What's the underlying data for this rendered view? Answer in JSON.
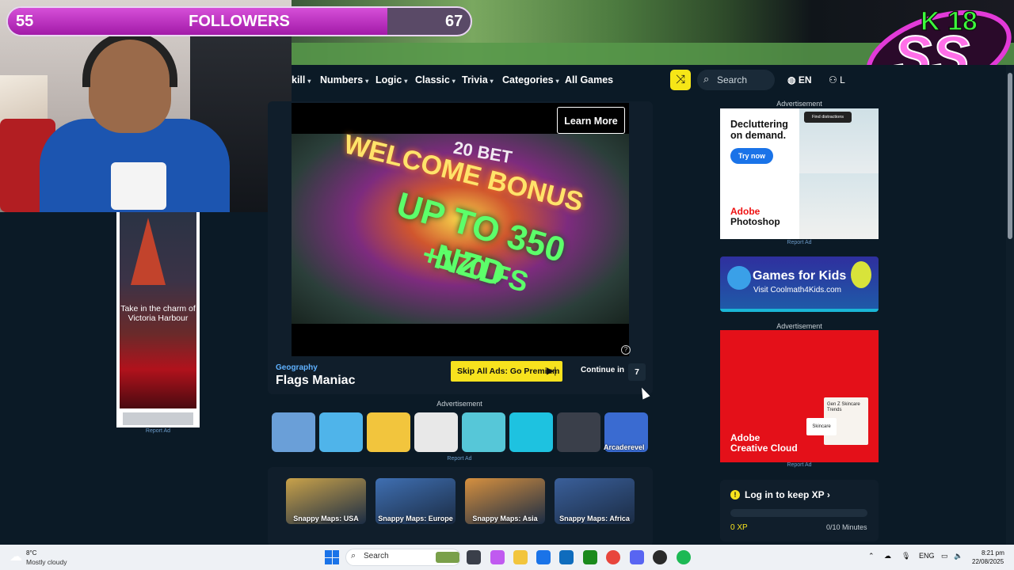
{
  "overlay": {
    "followers_label": "FOLLOWERS",
    "current": "55",
    "goal": "67",
    "progress_fraction": 0.82,
    "logo_text": "K 18",
    "logo_sub": "SS"
  },
  "nav": {
    "items": [
      {
        "label": "kill",
        "caret": true
      },
      {
        "label": "Numbers",
        "caret": true
      },
      {
        "label": "Logic",
        "caret": true
      },
      {
        "label": "Classic",
        "caret": true
      },
      {
        "label": "Trivia",
        "caret": true
      },
      {
        "label": "Categories",
        "caret": true
      },
      {
        "label": "All Games",
        "caret": false
      }
    ],
    "search_label": "Search",
    "language": "EN",
    "login_label": "L"
  },
  "video_ad": {
    "learn_more": "Learn More",
    "bet_brand": "20 BET",
    "headline1": "WELCOME BONUS",
    "headline2": "UP TO 350 NZD",
    "headline3": "+170 FS",
    "help": "?"
  },
  "game": {
    "category": "Geography",
    "title": "Flags Maniac",
    "skip_ads": "Skip All Ads: Go Premium",
    "continue_label": "Continue in",
    "countdown": "7"
  },
  "ads": {
    "advertisement": "Advertisement",
    "report": "Report Ad",
    "tiles_watermark": "Arcaderevel",
    "tiles": [
      "#6a9fd8",
      "#4fb4ea",
      "#f2c53d",
      "#e8e8e8",
      "#56c7d8",
      "#1ec2e0",
      "#3a3f4a",
      "#3a6bd1"
    ],
    "vertical_ad_text": "Take in the charm of Victoria Harbour",
    "photoshop_head": "Decluttering on demand.",
    "photoshop_cta": "Try now",
    "photoshop_brand1": "Adobe",
    "photoshop_brand2": "Photoshop",
    "photoshop_chip": "Find distractions",
    "kids_title": "Games for Kids",
    "kids_sub": "Visit Coolmath4Kids.com",
    "cc_brand1": "Adobe",
    "cc_brand2": "Creative Cloud",
    "cc_card_text": "Skincare",
    "cc_card_head": "Gen Z Skincare Trends"
  },
  "maps": [
    {
      "label": "Snappy Maps: USA",
      "color": "#c9a24a"
    },
    {
      "label": "Snappy Maps: Europe",
      "color": "#3f6fb2"
    },
    {
      "label": "Snappy Maps: Asia",
      "color": "#d6903f"
    },
    {
      "label": "Snappy Maps: Africa",
      "color": "#3a5f9a"
    }
  ],
  "xp": {
    "title": "Log in to keep XP",
    "value": "0 XP",
    "minutes": "0/10 Minutes",
    "icon": "!"
  },
  "taskbar": {
    "temp": "8°C",
    "weather": "Mostly cloudy",
    "search": "Search",
    "lang": "ENG",
    "time": "8:21 pm",
    "date": "22/08/2025"
  }
}
